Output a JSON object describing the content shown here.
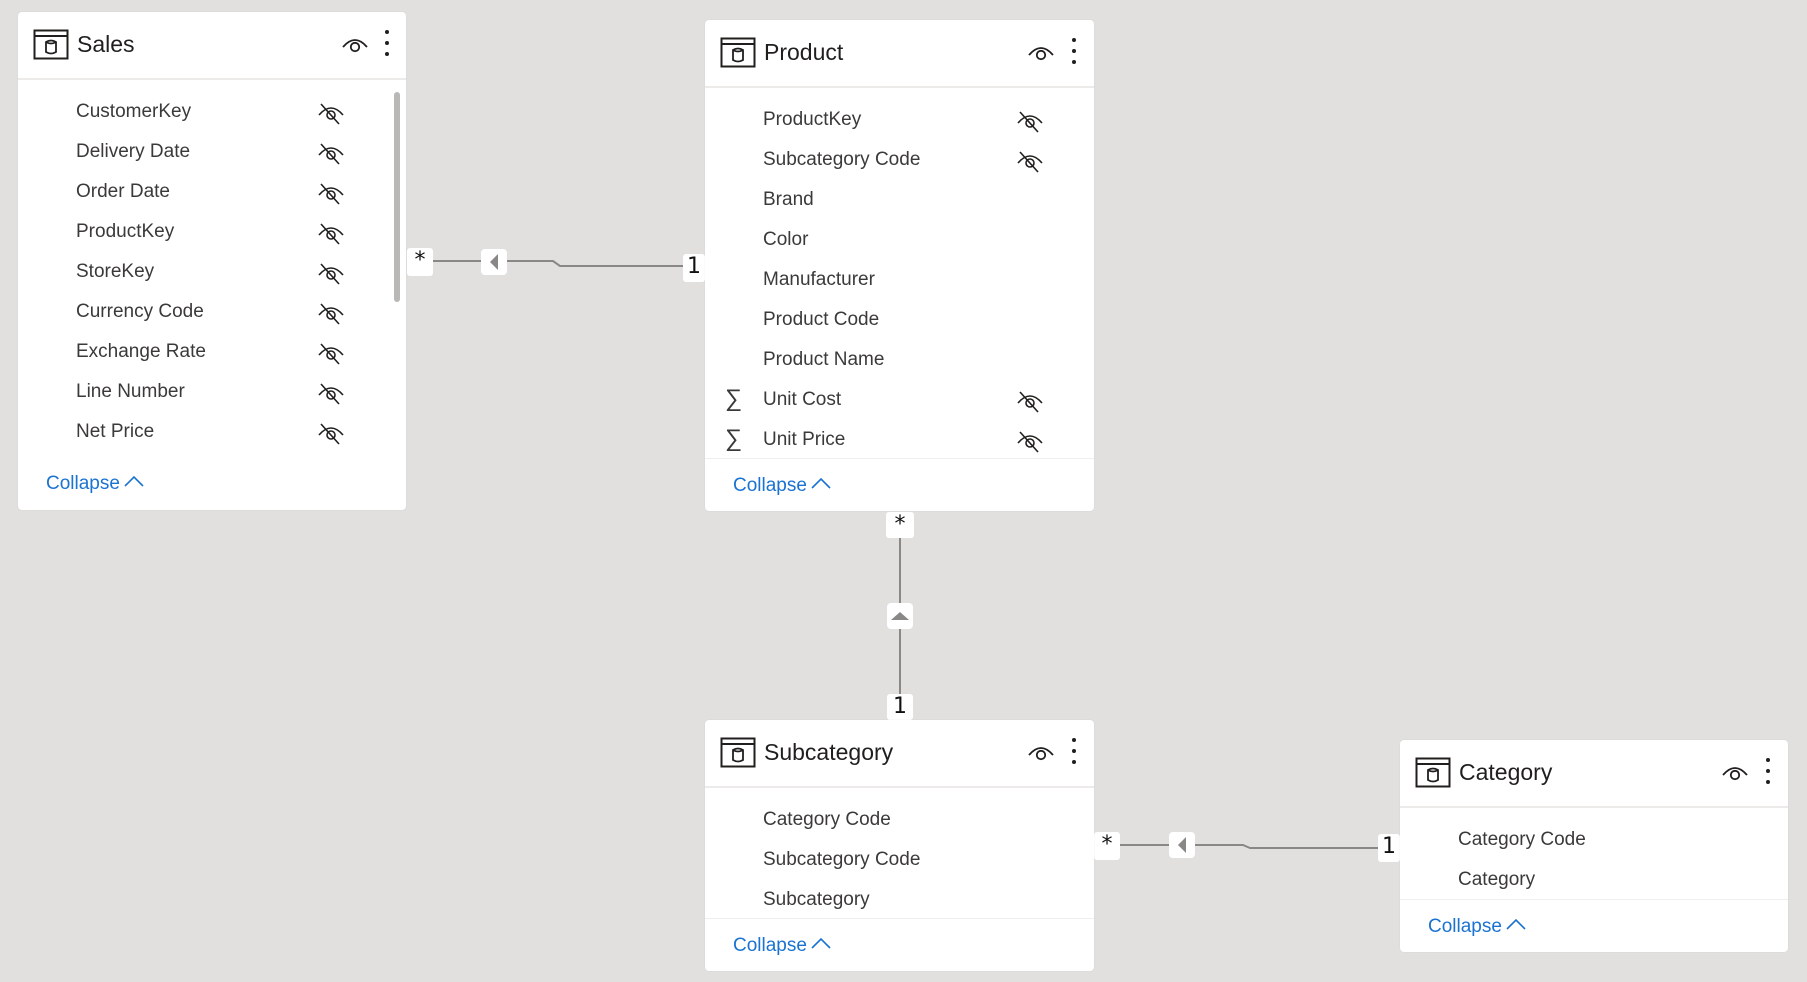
{
  "colors": {
    "canvas": "#e1e0df",
    "card": "#ffffff",
    "link_line": "#8a8886",
    "collapse_link": "#1a73d1",
    "text": "#3b3a39"
  },
  "tables": {
    "sales": {
      "title": "Sales",
      "icon": "table-icon",
      "fields": [
        {
          "name": "CustomerKey",
          "hidden": true
        },
        {
          "name": "Delivery Date",
          "hidden": true
        },
        {
          "name": "Order Date",
          "hidden": true
        },
        {
          "name": "ProductKey",
          "hidden": true
        },
        {
          "name": "StoreKey",
          "hidden": true
        },
        {
          "name": "Currency Code",
          "hidden": true
        },
        {
          "name": "Exchange Rate",
          "hidden": true
        },
        {
          "name": "Line Number",
          "hidden": true
        },
        {
          "name": "Net Price",
          "hidden": true
        }
      ],
      "collapse_label": "Collapse"
    },
    "product": {
      "title": "Product",
      "icon": "table-icon",
      "fields": [
        {
          "name": "ProductKey",
          "hidden": true,
          "aggregate": false
        },
        {
          "name": "Subcategory Code",
          "hidden": true,
          "aggregate": false
        },
        {
          "name": "Brand",
          "hidden": false,
          "aggregate": false
        },
        {
          "name": "Color",
          "hidden": false,
          "aggregate": false
        },
        {
          "name": "Manufacturer",
          "hidden": false,
          "aggregate": false
        },
        {
          "name": "Product Code",
          "hidden": false,
          "aggregate": false
        },
        {
          "name": "Product Name",
          "hidden": false,
          "aggregate": false
        },
        {
          "name": "Unit Cost",
          "hidden": true,
          "aggregate": true
        },
        {
          "name": "Unit Price",
          "hidden": true,
          "aggregate": true
        }
      ],
      "collapse_label": "Collapse"
    },
    "subcategory": {
      "title": "Subcategory",
      "icon": "table-icon",
      "fields": [
        {
          "name": "Category Code",
          "hidden": false
        },
        {
          "name": "Subcategory Code",
          "hidden": false
        },
        {
          "name": "Subcategory",
          "hidden": false
        }
      ],
      "collapse_label": "Collapse"
    },
    "category": {
      "title": "Category",
      "icon": "table-icon",
      "fields": [
        {
          "name": "Category Code",
          "hidden": false
        },
        {
          "name": "Category",
          "hidden": false
        }
      ],
      "collapse_label": "Collapse"
    }
  },
  "relationships": [
    {
      "from": "Sales",
      "to": "Product",
      "from_cardinality": "*",
      "to_cardinality": "1",
      "filter_direction": "toward Sales"
    },
    {
      "from": "Product",
      "to": "Subcategory",
      "from_cardinality": "*",
      "to_cardinality": "1",
      "filter_direction": "toward Product"
    },
    {
      "from": "Subcategory",
      "to": "Category",
      "from_cardinality": "*",
      "to_cardinality": "1",
      "filter_direction": "toward Subcategory"
    }
  ]
}
